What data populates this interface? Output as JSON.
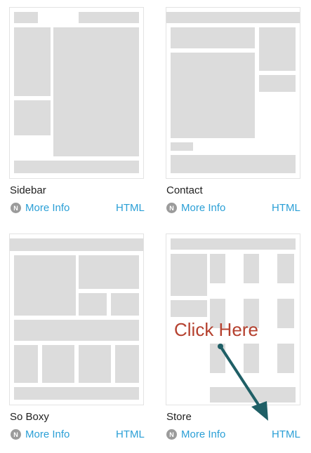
{
  "templates": [
    {
      "title": "Sidebar",
      "more_info": "More Info",
      "html": "HTML"
    },
    {
      "title": "Contact",
      "more_info": "More Info",
      "html": "HTML"
    },
    {
      "title": "So Boxy",
      "more_info": "More Info",
      "html": "HTML"
    },
    {
      "title": "Store",
      "more_info": "More Info",
      "html": "HTML"
    }
  ],
  "annotation": {
    "text": "Click Here",
    "color": "#b5412f",
    "arrow_color": "#1f5f66"
  },
  "colors": {
    "link": "#2a9fd6",
    "placeholder": "#dcdcdc",
    "icon_bg": "#9b9b9b"
  },
  "icons": {
    "more_info": "n-badge-icon"
  }
}
